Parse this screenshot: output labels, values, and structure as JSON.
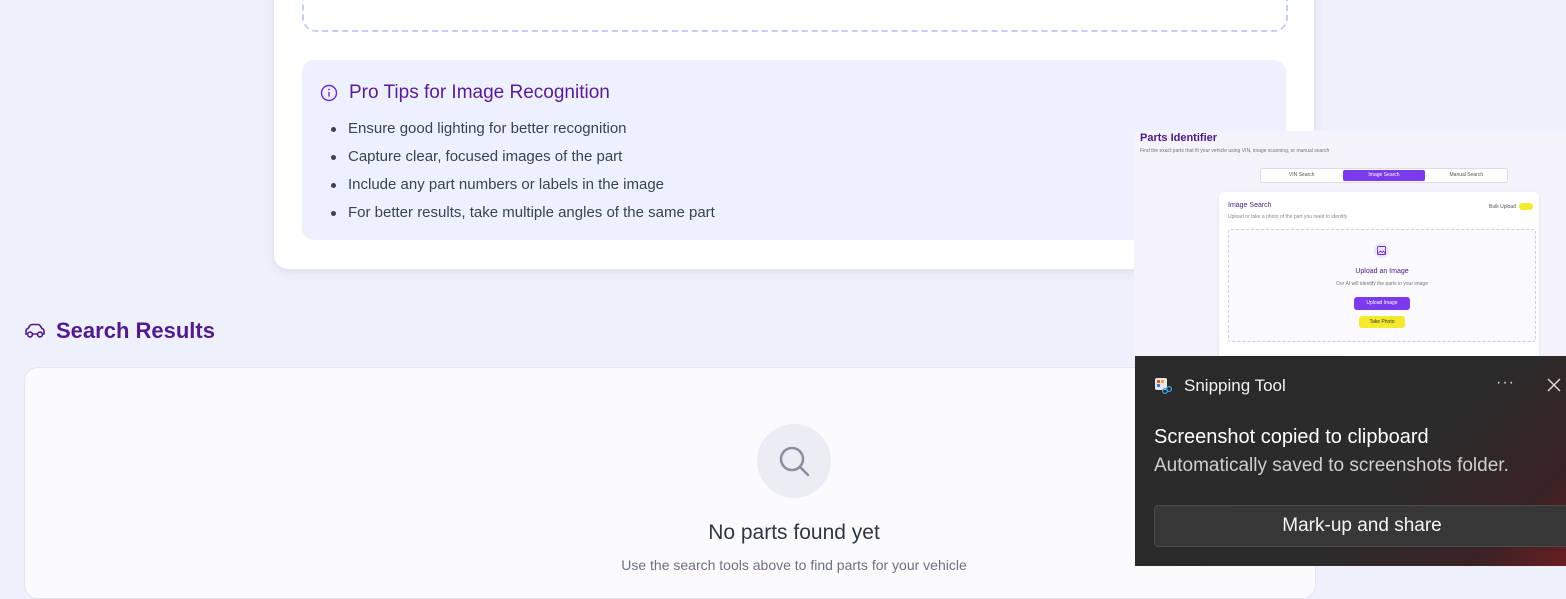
{
  "tips": {
    "title": "Pro Tips for Image Recognition",
    "items": [
      "Ensure good lighting for better recognition",
      "Capture clear, focused images of the part",
      "Include any part numbers or labels in the image",
      "For better results, take multiple angles of the same part"
    ]
  },
  "results": {
    "title": "Search Results",
    "empty_title": "No parts found yet",
    "empty_subtitle": "Use the search tools above to find parts for your vehicle"
  },
  "preview": {
    "title": "Parts Identifier",
    "subtitle": "Find the exact parts that fit your vehicle using VIN, image scanning, or manual search",
    "tabs": [
      "VIN Search",
      "Image Search",
      "Manual Search"
    ],
    "active_tab": "Image Search",
    "card_title": "Image Search",
    "bulk_label": "Bulk Upload",
    "card_subtitle": "Upload or take a photo of the part you need to identify",
    "upload_title": "Upload an Image",
    "upload_subtitle": "Our AI will identify the parts in your image",
    "upload_button": "Upload Image",
    "photo_button": "Take Photo"
  },
  "toast": {
    "app_name": "Snipping Tool",
    "more_label": "···",
    "headline": "Screenshot copied to clipboard",
    "body": "Automatically saved to screenshots folder.",
    "action": "Mark-up and share"
  },
  "colors": {
    "accent": "#7c3aed",
    "heading": "#521a8c",
    "highlight": "#f5e92c"
  }
}
